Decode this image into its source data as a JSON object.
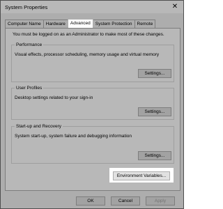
{
  "window": {
    "title": "System Properties",
    "close_glyph": "✕"
  },
  "tabs": [
    "Computer Name",
    "Hardware",
    "Advanced",
    "System Protection",
    "Remote"
  ],
  "active_tab": "Advanced",
  "admin_note": "You must be logged on as an Administrator to make most of these changes.",
  "performance": {
    "title": "Performance",
    "description": "Visual effects, processor scheduling, memory usage and virtual memory",
    "button": "Settings..."
  },
  "user_profiles": {
    "title": "User Profiles",
    "description": "Desktop settings related to your sign-in",
    "button": "Settings..."
  },
  "startup_recovery": {
    "title": "Start-up and Recovery",
    "description": "System start-up, system failure and debugging information",
    "button": "Settings..."
  },
  "env_button": "Environment Variables...",
  "footer": {
    "ok": "OK",
    "cancel": "Cancel",
    "apply": "Apply"
  }
}
